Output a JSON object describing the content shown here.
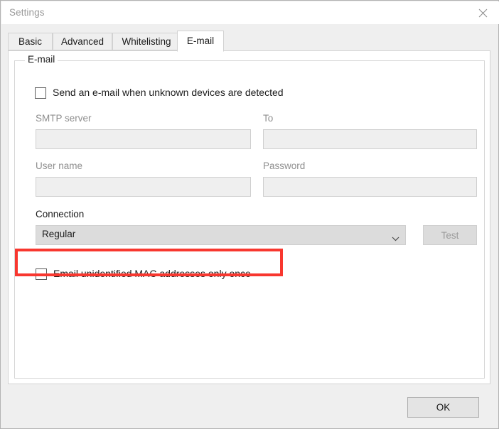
{
  "window": {
    "title": "Settings",
    "close_icon": "close-icon"
  },
  "tabs": [
    {
      "label": "Basic",
      "active": false
    },
    {
      "label": "Advanced",
      "active": false
    },
    {
      "label": "Whitelisting",
      "active": false
    },
    {
      "label": "E-mail",
      "active": true
    }
  ],
  "group": {
    "legend": "E-mail"
  },
  "checkboxes": {
    "send_email": {
      "label": "Send an e-mail when unknown devices are detected",
      "checked": false
    },
    "once_only": {
      "label": "Email unidentified MAC addresses only once",
      "checked": false,
      "highlighted": true
    }
  },
  "fields": {
    "smtp_server": {
      "label": "SMTP server",
      "value": "",
      "placeholder": "",
      "enabled": false
    },
    "to": {
      "label": "To",
      "value": "",
      "placeholder": "",
      "enabled": false
    },
    "user_name": {
      "label": "User name",
      "value": "",
      "placeholder": "",
      "enabled": false
    },
    "password": {
      "label": "Password",
      "value": "",
      "placeholder": "",
      "enabled": false
    }
  },
  "connection": {
    "label": "Connection",
    "selected": "Regular",
    "options": [
      "Regular"
    ],
    "chevron_icon": "chevron-down-icon"
  },
  "buttons": {
    "test": {
      "label": "Test",
      "enabled": false
    },
    "ok": {
      "label": "OK",
      "enabled": true
    }
  },
  "colors": {
    "highlight": "#f8372f",
    "window_bg": "#efefef",
    "panel_bg": "#ffffff",
    "disabled_text": "#8e8e8e"
  }
}
